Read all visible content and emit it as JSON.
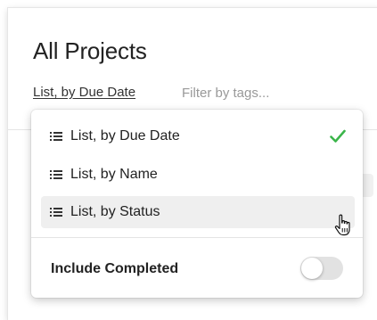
{
  "header": {
    "title": "All Projects",
    "view_link": "List, by Due Date",
    "filter_placeholder": "Filter by tags..."
  },
  "dropdown": {
    "items": [
      {
        "label": "List, by Due Date",
        "icon": "list-icon",
        "selected": true
      },
      {
        "label": "List, by Name",
        "icon": "list-icon",
        "selected": false
      },
      {
        "label": "List, by Status",
        "icon": "list-icon",
        "selected": false,
        "hovered": true
      }
    ],
    "include_completed": {
      "label": "Include Completed",
      "enabled": false
    }
  },
  "colors": {
    "check": "#3bb54a",
    "hover_bg": "#efefef",
    "toggle_off": "#e2e2e2"
  },
  "cursor": "hand-pointer"
}
